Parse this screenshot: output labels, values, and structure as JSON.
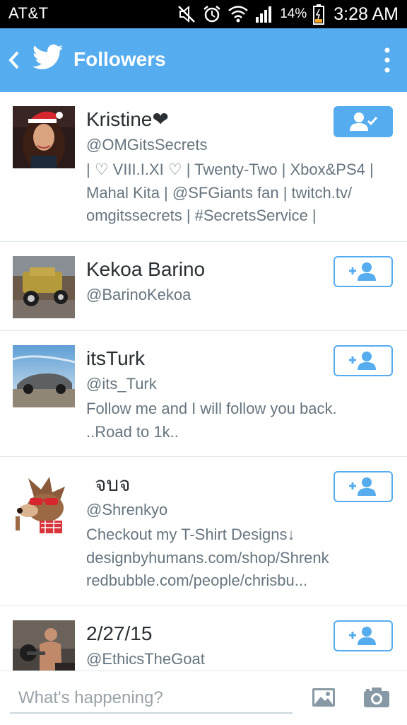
{
  "status_bar": {
    "carrier": "AT&T",
    "battery_percent": "14%",
    "time": "3:28 AM",
    "icons": [
      "mute-icon",
      "alarm-icon",
      "wifi-icon",
      "signal-icon",
      "battery-icon"
    ]
  },
  "header": {
    "title": "Followers",
    "icons": [
      "back-icon",
      "twitter-bird-icon",
      "overflow-menu-icon"
    ],
    "color": "#55acee"
  },
  "users": [
    {
      "name": "Kristine❤",
      "handle": "@OMGitsSecrets",
      "bio": "| ♡ VIII.I.XI ♡ | Twenty-Two | Xbox&PS4 |\nMahal Kita | @SFGiants fan | twitch.tv/\nomgitssecrets | #SecretsService |",
      "follow_state": "following"
    },
    {
      "name": "Kekoa Barino",
      "handle": "@BarinoKekoa",
      "bio": "",
      "follow_state": "follow"
    },
    {
      "name": "itsTurk",
      "handle": "@its_Turk",
      "bio": "Follow me and I will follow you back.\n..Road to 1k..",
      "follow_state": "follow"
    },
    {
      "name": "จบจ",
      "handle": "@Shrenkyo",
      "bio": "Checkout my T-Shirt Designs↓\ndesignbyhumans.com/shop/Shrenk\nredbubble.com/people/chrisbu...",
      "follow_state": "follow"
    },
    {
      "name": "2/27/15",
      "handle": "@EthicsTheGoat",
      "bio": "",
      "follow_state": "follow"
    }
  ],
  "compose": {
    "placeholder": "What's happening?",
    "icons": [
      "photo-icon",
      "camera-icon"
    ]
  },
  "colors": {
    "twitter_blue": "#55acee",
    "secondary_text": "#66757f",
    "divider": "#e1e8ed"
  }
}
